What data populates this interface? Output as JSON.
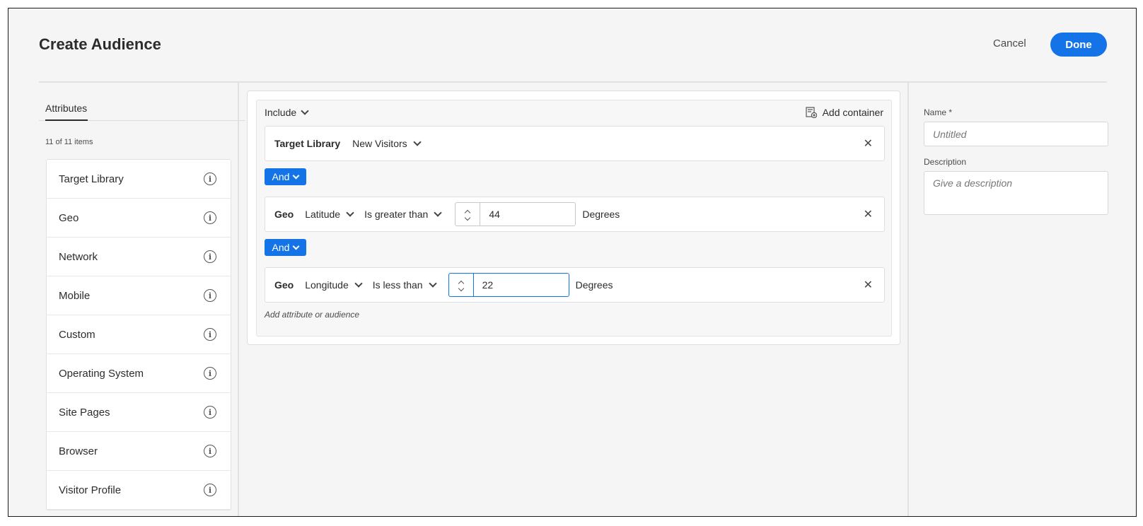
{
  "header": {
    "title": "Create Audience",
    "cancel_label": "Cancel",
    "done_label": "Done"
  },
  "left": {
    "tab_label": "Attributes",
    "items_count": "11 of 11 items",
    "items": [
      {
        "label": "Target Library"
      },
      {
        "label": "Geo"
      },
      {
        "label": "Network"
      },
      {
        "label": "Mobile"
      },
      {
        "label": "Custom"
      },
      {
        "label": "Operating System"
      },
      {
        "label": "Site Pages"
      },
      {
        "label": "Browser"
      },
      {
        "label": "Visitor Profile"
      }
    ],
    "info_icon": "info-icon"
  },
  "builder": {
    "include_label": "Include",
    "add_container_label": "Add container",
    "and_label": "And",
    "add_attribute_label": "Add attribute or audience",
    "rules": [
      {
        "category": "Target Library",
        "attribute": "New Visitors"
      },
      {
        "category": "Geo",
        "attribute": "Latitude",
        "operator": "Is greater than",
        "value": "44",
        "unit": "Degrees"
      },
      {
        "category": "Geo",
        "attribute": "Longitude",
        "operator": "Is less than",
        "value": "22",
        "unit": "Degrees"
      }
    ],
    "close_glyph": "✕"
  },
  "details": {
    "name_label": "Name *",
    "name_placeholder": "Untitled",
    "description_label": "Description",
    "description_placeholder": "Give a description"
  },
  "colors": {
    "accent": "#1473e6",
    "background": "#f5f5f5"
  }
}
